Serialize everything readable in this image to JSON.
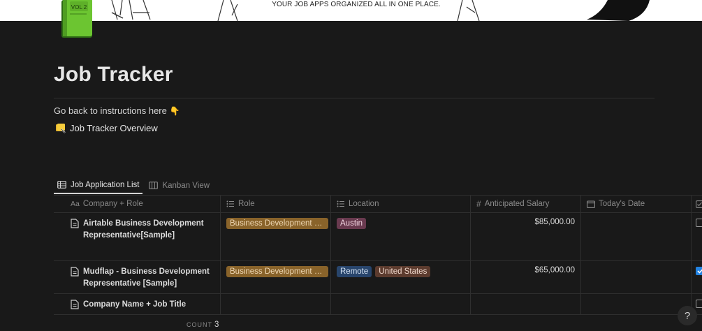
{
  "cover": {
    "tagline": "YOUR JOB APPS ORGANIZED ALL IN ONE PLACE."
  },
  "page": {
    "icon_label": "VOL 2",
    "title": "Job Tracker",
    "instructions_text": "Go back to instructions here",
    "hand_glyph": "👇",
    "overview_link": "Job Tracker Overview"
  },
  "tabs": [
    {
      "label": "Job Application List",
      "active": true,
      "icon": "table-icon"
    },
    {
      "label": "Kanban View",
      "active": false,
      "icon": "board-icon"
    }
  ],
  "table": {
    "columns": [
      {
        "label": "Company + Role",
        "icon": "text-icon"
      },
      {
        "label": "Role",
        "icon": "list-icon"
      },
      {
        "label": "Location",
        "icon": "list-icon"
      },
      {
        "label": "Anticipated Salary",
        "icon": "number-icon"
      },
      {
        "label": "Today's Date",
        "icon": "calendar-icon"
      }
    ],
    "rows": [
      {
        "name": "Airtable Business Development Representative[Sample]",
        "role": "Business Development R...",
        "locations": [
          "Austin"
        ],
        "salary": "$85,000.00",
        "date": "",
        "checked": false
      },
      {
        "name": "Mudflap - Business Development Representative [Sample]",
        "role": "Business Development R...",
        "locations": [
          "Remote",
          "United States"
        ],
        "salary": "$65,000.00",
        "date": "",
        "checked": true
      },
      {
        "name": "Company Name + Job Title",
        "role": "",
        "locations": [],
        "salary": "",
        "date": "",
        "checked": false
      }
    ],
    "count_label": "COUNT",
    "count_value": "3"
  },
  "colors": {
    "role_tag_bg": "#89632a",
    "role_tag_fg": "#f0d9b5",
    "austin_tag_bg": "#693a4f",
    "remote_tag_bg": "#28456c",
    "us_tag_bg": "#5c3b2e",
    "tag_fg": "#e8e8e8",
    "checkbox_on": "#2383e2"
  },
  "help": {
    "label": "?"
  }
}
